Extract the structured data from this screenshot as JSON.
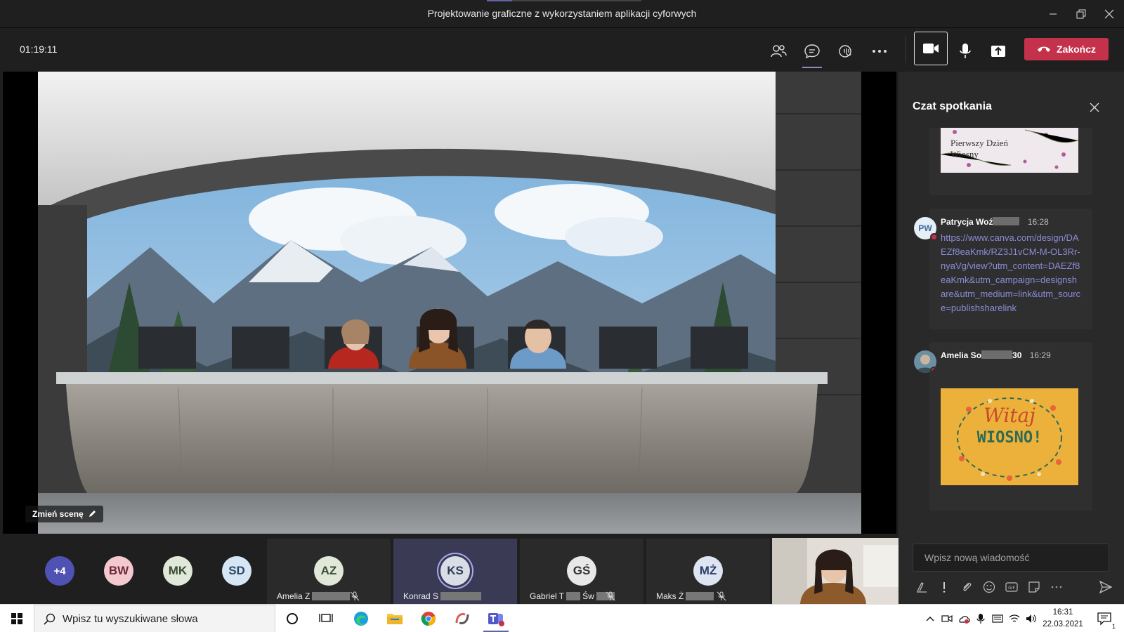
{
  "window": {
    "title": "Projektowanie graficzne z wykorzystaniem aplikacji cyforwych"
  },
  "toolbar": {
    "timer": "01:19:11",
    "end_label": "Zakończ"
  },
  "stage": {
    "change_scene_label": "Zmień scenę"
  },
  "chat": {
    "title": "Czat spotkania",
    "image1_text": "Pierwszy Dzień Wiosny",
    "messages": [
      {
        "avatar": "PW",
        "author": "Patrycja Woź",
        "time": "16:28",
        "link": "https://www.canva.com/design/DAEZf8eaKmk/RZ3J1vCM-M-OL3Rr-nyaVg/view?utm_content=DAEZf8eaKmk&utm_campaign=designshare&utm_medium=link&utm_source=publishsharelink"
      },
      {
        "author": "Amelia So",
        "author_suffix": "30",
        "time": "16:29",
        "image_line1": "Witaj",
        "image_line2": "WIOSNO!"
      }
    ],
    "compose_placeholder": "Wpisz nową wiadomość"
  },
  "participants": {
    "overflow": "+4",
    "circles": [
      {
        "initials": "BW",
        "bg": "#f4c8cf",
        "fg": "#6b2a35"
      },
      {
        "initials": "MK",
        "bg": "#dfe8d9",
        "fg": "#3b4d33"
      },
      {
        "initials": "SD",
        "bg": "#d6e6f4",
        "fg": "#2f4a66"
      }
    ],
    "tiles": [
      {
        "initials": "AZ",
        "name": "Amelia Z",
        "bg": "#dfe8d9",
        "fg": "#3b4d33"
      },
      {
        "initials": "KS",
        "name": "Konrad S",
        "bg": "#d8dde6",
        "fg": "#2f3c55"
      },
      {
        "initials": "GŚ",
        "name": "Gabriel T",
        "name2": "Św",
        "bg": "#e8e8e8",
        "fg": "#333333"
      },
      {
        "initials": "MŻ",
        "name": "Maks Ż",
        "bg": "#dde5f3",
        "fg": "#2c3e66"
      }
    ]
  },
  "taskbar": {
    "search_placeholder": "Wpisz tu wyszukiwane słowa",
    "time": "16:31",
    "date": "22.03.2021",
    "notification_count": "1"
  },
  "colors": {
    "accent": "#6264a7",
    "end_call": "#c4314b",
    "link": "#8a8cd8"
  }
}
